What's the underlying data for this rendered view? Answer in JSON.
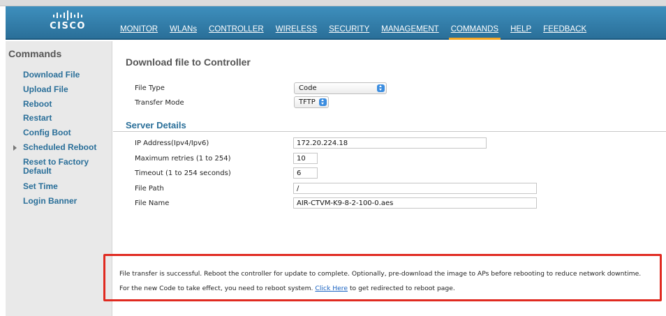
{
  "brand": {
    "logo_text": "CISCO"
  },
  "nav": [
    {
      "label": "MONITOR"
    },
    {
      "label": "WLANs"
    },
    {
      "label": "CONTROLLER"
    },
    {
      "label": "WIRELESS"
    },
    {
      "label": "SECURITY"
    },
    {
      "label": "MANAGEMENT"
    },
    {
      "label": "COMMANDS",
      "active": true
    },
    {
      "label": "HELP"
    },
    {
      "label": "FEEDBACK"
    }
  ],
  "sidebar": {
    "title": "Commands",
    "items": [
      {
        "label": "Download File"
      },
      {
        "label": "Upload File"
      },
      {
        "label": "Reboot"
      },
      {
        "label": "Restart"
      },
      {
        "label": "Config Boot"
      },
      {
        "label": "Scheduled Reboot",
        "expandable": true
      },
      {
        "label": "Reset to Factory Default"
      },
      {
        "label": "Set Time"
      },
      {
        "label": "Login Banner"
      }
    ]
  },
  "page": {
    "title": "Download file to Controller",
    "file_type": {
      "label": "File Type",
      "value": "Code"
    },
    "transfer_mode": {
      "label": "Transfer Mode",
      "value": "TFTP"
    },
    "server_section": "Server Details",
    "ip_address": {
      "label": "IP Address(Ipv4/Ipv6)",
      "value": "172.20.224.18"
    },
    "max_retries": {
      "label": "Maximum retries (1 to 254)",
      "value": "10"
    },
    "timeout": {
      "label": "Timeout (1 to 254 seconds)",
      "value": "6"
    },
    "file_path": {
      "label": "File Path",
      "value": "/"
    },
    "file_name": {
      "label": "File Name",
      "value": "AIR-CTVM-K9-8-2-100-0.aes"
    }
  },
  "message": {
    "line1": "File transfer is successful. Reboot the controller for update to complete. Optionally, pre-download the image to APs before rebooting to reduce network downtime.",
    "line2_prefix": "For the new Code to take effect, you need to reboot system.",
    "link": "Click Here",
    "line2_suffix": "to get redirected to reboot page."
  },
  "colors": {
    "header": "#2f7aa8",
    "accent": "#f5a623",
    "link": "#2a6f99",
    "highlight_border": "#e02a20"
  }
}
